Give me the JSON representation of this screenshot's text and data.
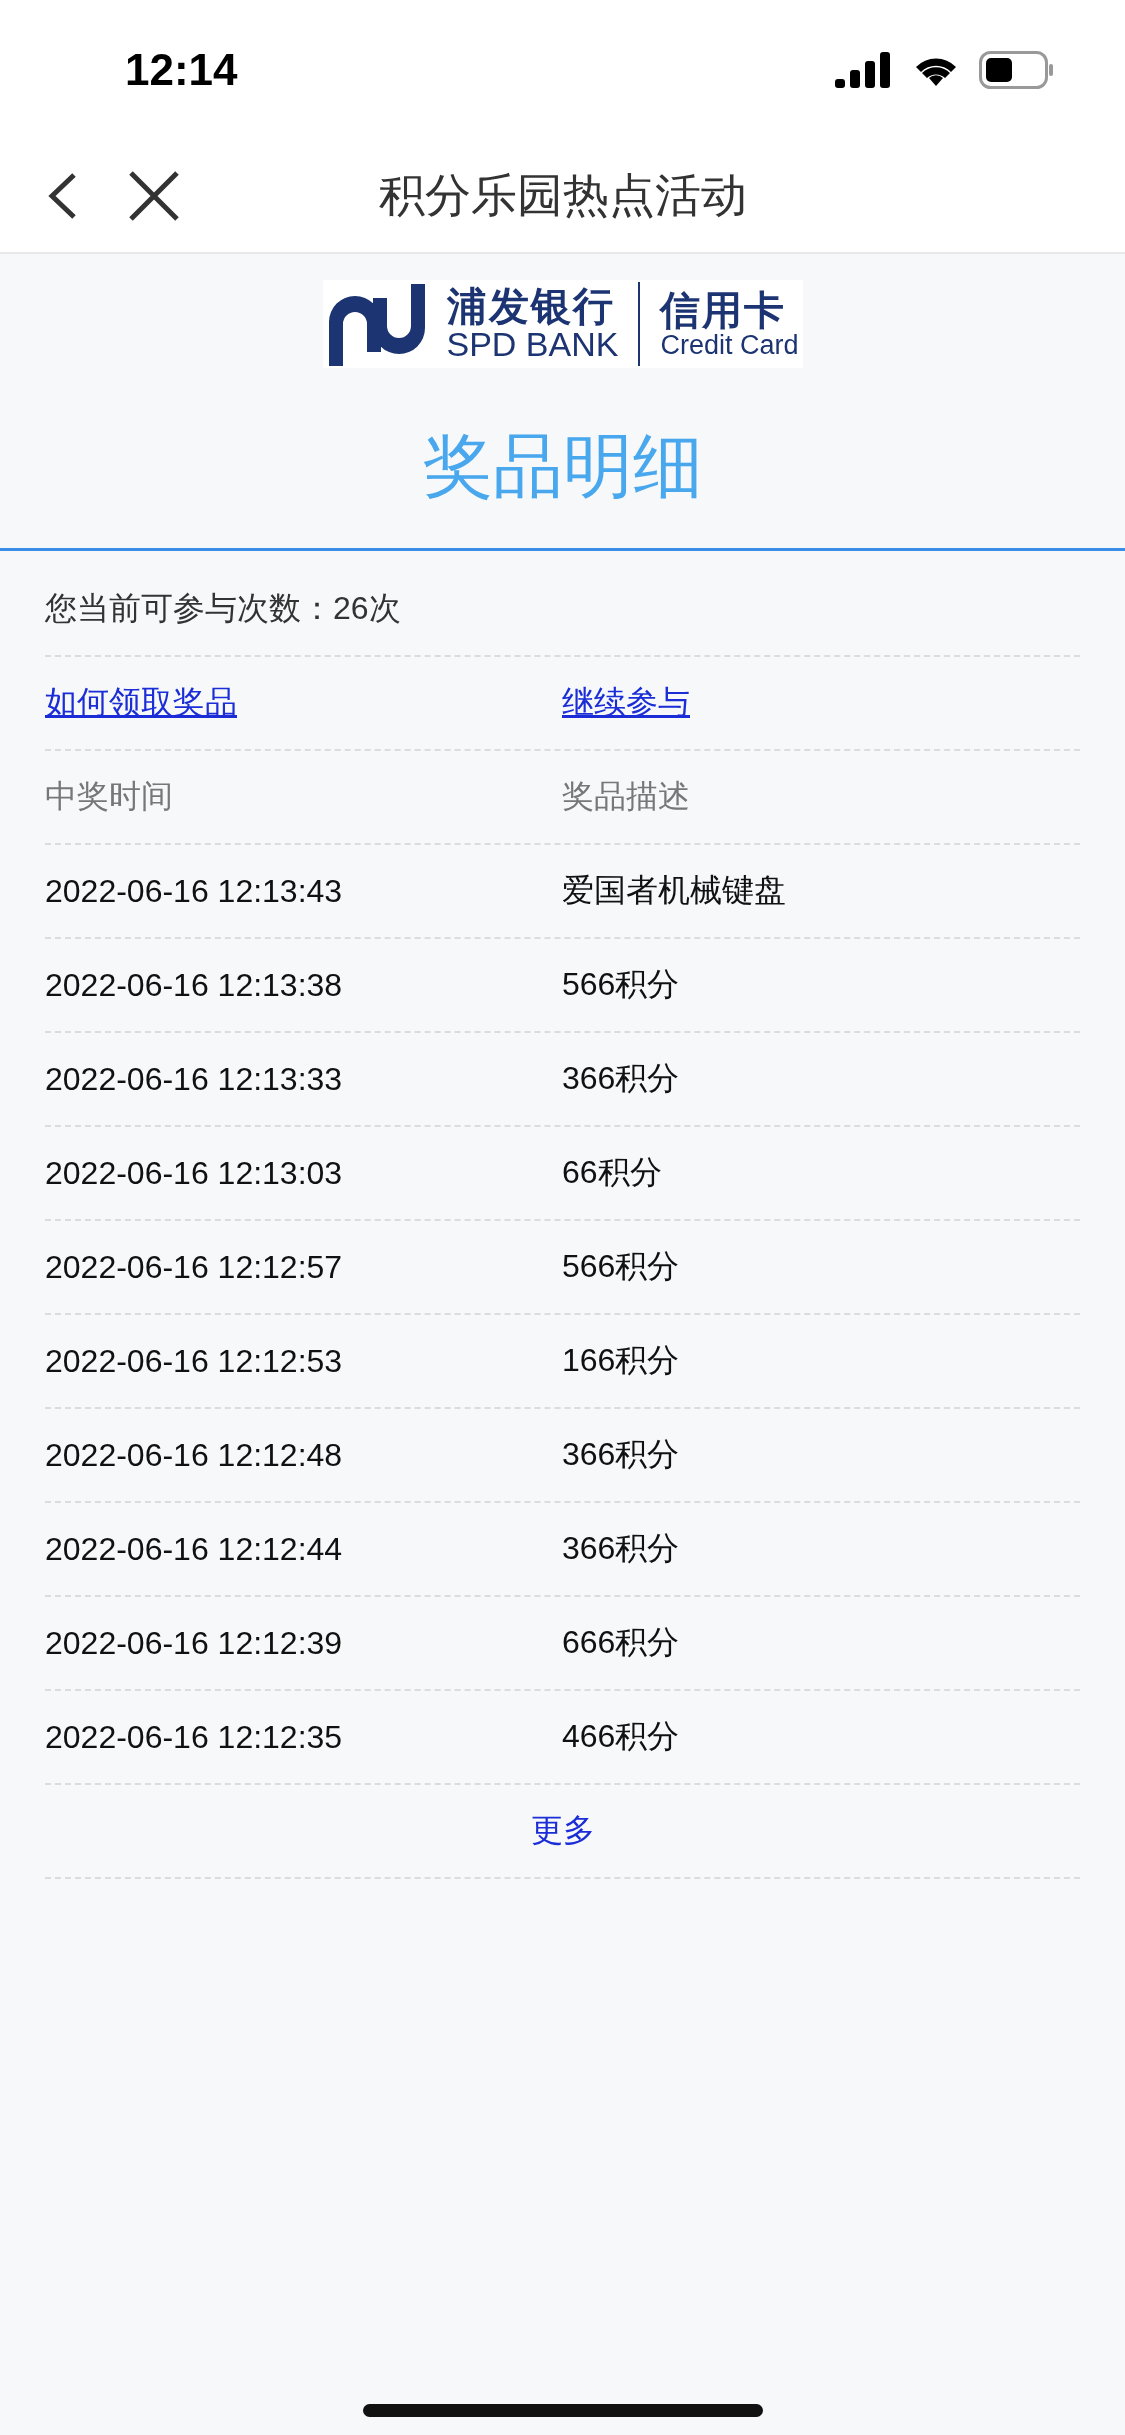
{
  "status_bar": {
    "time": "12:14"
  },
  "nav": {
    "title": "积分乐园热点活动"
  },
  "logo": {
    "name_cn": "浦发银行",
    "name_en": "SPD BANK",
    "product_cn": "信用卡",
    "product_en": "Credit Card"
  },
  "page_title": "奖品明细",
  "remaining": "您当前可参与次数：26次",
  "links": [
    "如何领取奖品",
    "继续参与"
  ],
  "table": {
    "columns": [
      "中奖时间",
      "奖品描述"
    ],
    "rows": [
      {
        "time": "2022-06-16 12:13:43",
        "prize": "爱国者机械键盘"
      },
      {
        "time": "2022-06-16 12:13:38",
        "prize": "566积分"
      },
      {
        "time": "2022-06-16 12:13:33",
        "prize": "366积分"
      },
      {
        "time": "2022-06-16 12:13:03",
        "prize": "66积分"
      },
      {
        "time": "2022-06-16 12:12:57",
        "prize": "566积分"
      },
      {
        "time": "2022-06-16 12:12:53",
        "prize": "166积分"
      },
      {
        "time": "2022-06-16 12:12:48",
        "prize": "366积分"
      },
      {
        "time": "2022-06-16 12:12:44",
        "prize": "366积分"
      },
      {
        "time": "2022-06-16 12:12:39",
        "prize": "666积分"
      },
      {
        "time": "2022-06-16 12:12:35",
        "prize": "466积分"
      }
    ]
  },
  "more": "更多"
}
